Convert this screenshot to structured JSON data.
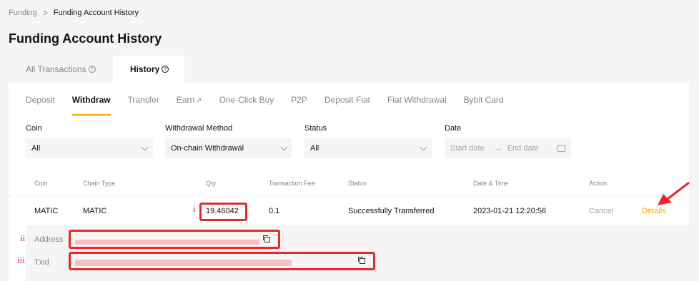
{
  "breadcrumb": {
    "parent": "Funding",
    "separator": ">",
    "current": "Funding Account History"
  },
  "page_title": "Funding Account History",
  "top_tabs": [
    {
      "label": "All Transactions"
    },
    {
      "label": "History"
    }
  ],
  "sub_tabs": [
    {
      "label": "Deposit"
    },
    {
      "label": "Withdraw"
    },
    {
      "label": "Transfer"
    },
    {
      "label": "Earn"
    },
    {
      "label": "One-Click Buy"
    },
    {
      "label": "P2P"
    },
    {
      "label": "Deposit Fiat"
    },
    {
      "label": "Fiat Withdrawal"
    },
    {
      "label": "Bybit Card"
    }
  ],
  "filters": {
    "coin": {
      "label": "Coin",
      "value": "All"
    },
    "method": {
      "label": "Withdrawal Method",
      "value": "On-chain Withdrawal"
    },
    "status": {
      "label": "Status",
      "value": "All"
    },
    "date": {
      "label": "Date",
      "start_placeholder": "Start date",
      "arrow": "→",
      "end_placeholder": "End date"
    }
  },
  "table": {
    "headers": [
      "Coin",
      "Chain Type",
      "Qty",
      "Transaction Fee",
      "Status",
      "Date & Time",
      "Action"
    ],
    "row": {
      "coin": "MATIC",
      "chain_type": "MATIC",
      "qty": "19.46042",
      "fee": "0.1",
      "status": "Successfully Transferred",
      "datetime": "2023-01-21 12:20:56",
      "cancel": "Cancel",
      "details": "Details"
    },
    "expanded": {
      "address_label": "Address",
      "txid_label": "Txid"
    }
  },
  "annotations": {
    "i": "i",
    "ii": "ii",
    "iii": "iii"
  },
  "colors": {
    "accent": "#f7a600",
    "annotation": "#e8282b"
  }
}
